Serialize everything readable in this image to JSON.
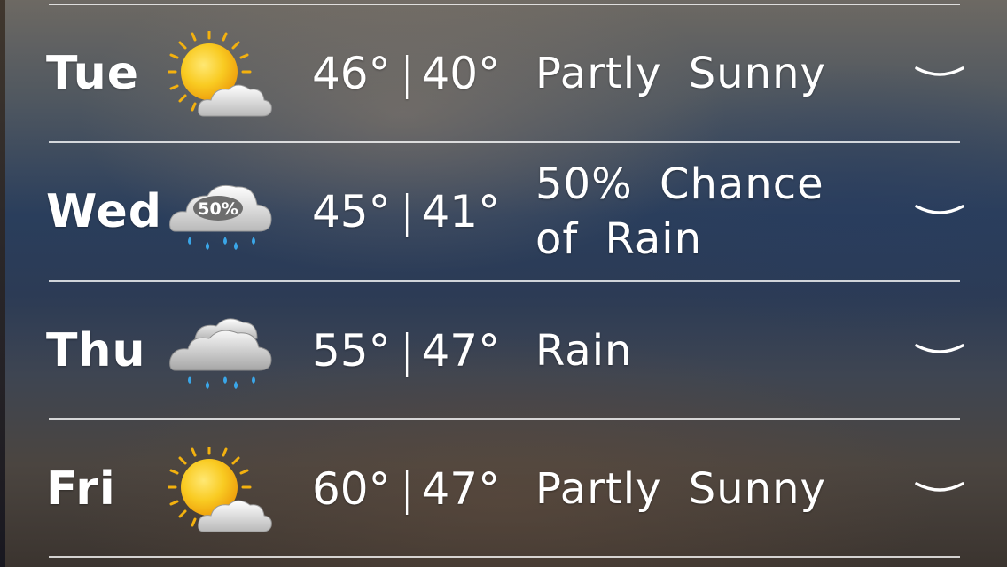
{
  "forecast": [
    {
      "day": "Tue",
      "high": "46°",
      "low": "40°",
      "separator": "|",
      "condition": "Partly Sunny",
      "icon": "partly-sunny-icon"
    },
    {
      "day": "Wed",
      "high": "45°",
      "low": "41°",
      "separator": "|",
      "condition": "50% Chance of Rain",
      "icon": "rain-chance-icon",
      "icon_badge": "50%"
    },
    {
      "day": "Thu",
      "high": "55°",
      "low": "47°",
      "separator": "|",
      "condition": "Rain",
      "icon": "rain-icon"
    },
    {
      "day": "Fri",
      "high": "60°",
      "low": "47°",
      "separator": "|",
      "condition": "Partly Sunny",
      "icon": "partly-sunny-icon"
    }
  ],
  "colors": {
    "text": "#ffffff",
    "divider": "#ffffff",
    "sun": "#f7c21b",
    "cloud": "#e4e4e4",
    "raindrop": "#3aa6e8"
  }
}
